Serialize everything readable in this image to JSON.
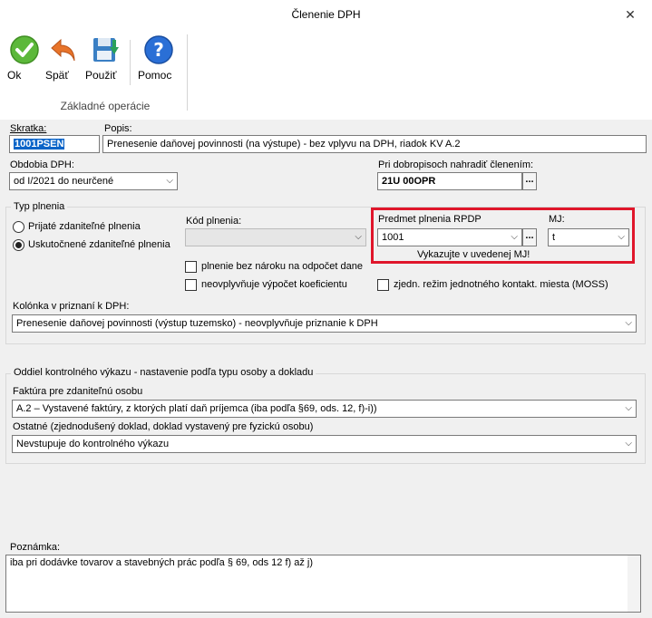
{
  "window": {
    "title": "Členenie DPH",
    "close_glyph": "✕"
  },
  "ribbon": {
    "buttons": [
      {
        "label": "Ok",
        "icon": "ok-check-icon",
        "color": "#5cb83a"
      },
      {
        "label": "Späť",
        "icon": "undo-arrow-icon",
        "color": "#e8742a"
      },
      {
        "label": "Použiť",
        "icon": "save-download-icon",
        "color": "#2aa15a"
      },
      {
        "label": "Pomoc",
        "icon": "help-question-icon",
        "color": "#2a6fd6"
      }
    ],
    "group_caption": "Základné operácie"
  },
  "form": {
    "skratka": {
      "label": "Skratka:",
      "value": "1001PSEN"
    },
    "popis": {
      "label": "Popis:",
      "value": "Prenesenie daňovej povinnosti  (na výstupe) - bez vplyvu na DPH, riadok KV A.2"
    },
    "obdobia": {
      "label": "Obdobia DPH:",
      "value": "od I/2021 do neurčené"
    },
    "dobropis": {
      "label": "Pri dobropisoch nahradiť členením:",
      "value": "21U 00OPR",
      "btn": "..."
    },
    "typ_plnenia": {
      "legend": "Typ plnenia",
      "options": [
        "Prijaté zdaniteľné plnenia",
        "Uskutočnené zdaniteľné plnenia"
      ],
      "selected": 1
    },
    "kod_plnenia": {
      "label": "Kód plnenia:",
      "value": ""
    },
    "predmet": {
      "label": "Predmet plnenia RPDP",
      "value": "1001",
      "btn": "..."
    },
    "mj": {
      "label": "MJ:",
      "value": "t"
    },
    "vykazujte": "Vykazujte v uvedenej MJ!",
    "checkboxes": {
      "bez_naroku": "plnenie bez nároku na odpočet dane",
      "neovplyvnuje": "neovplyvňuje výpočet koeficientu",
      "moss": "zjedn. režim jednotného kontakt. miesta (MOSS)"
    },
    "kolonka": {
      "label": "Kolónka v priznaní k DPH:",
      "value": "Prenesenie daňovej povinnosti (výstup tuzemsko) - neovplyvňuje priznanie k DPH"
    },
    "kv": {
      "legend": "Oddiel kontrolného výkazu - nastavenie podľa typu osoby a dokladu",
      "faktura_label": "Faktúra pre zdaniteľnú osobu",
      "faktura_value": "A.2 – Vystavené faktúry, z ktorých platí daň príjemca (iba podľa §69, ods. 12, f)-i))",
      "ostatne_label": "Ostatné (zjednodušený doklad, doklad vystavený pre fyzickú osobu)",
      "ostatne_value": "Nevstupuje do kontrolného výkazu"
    },
    "poznamka": {
      "label": "Poznámka:",
      "value": "iba pri dodávke tovarov a stavebných prác podľa § 69, ods 12 f) až j)"
    }
  },
  "colors": {
    "highlight": "#e0162b",
    "selection": "#0a64c8"
  }
}
